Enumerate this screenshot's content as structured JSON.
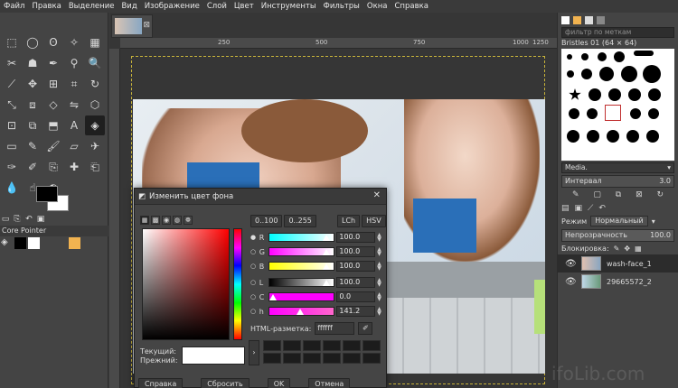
{
  "menubar": [
    "Файл",
    "Правка",
    "Выделение",
    "Вид",
    "Изображение",
    "Слой",
    "Цвет",
    "Инструменты",
    "Фильтры",
    "Окна",
    "Справка"
  ],
  "toolbox": {
    "device_status_label": "Core Pointer"
  },
  "canvas": {
    "ruler_marks": [
      "250",
      "500",
      "750",
      "1000",
      "1250"
    ]
  },
  "dock": {
    "filter_placeholder": "фильтр по меткам",
    "brush_title": "Bristles 01 (64 × 64)",
    "brush_tag": "Media.",
    "interval_label": "Интервал",
    "interval_value": "3.0",
    "mode_label": "Режим",
    "mode_value": "Нормальный",
    "opacity_label": "Непрозрачность",
    "opacity_value": "100.0",
    "lock_label": "Блокировка:",
    "layers": [
      {
        "name": "wash-face_1"
      },
      {
        "name": "29665572_2"
      }
    ]
  },
  "dialog": {
    "title": "Изменить цвет фона",
    "scale_buttons": [
      "0..100",
      "0..255"
    ],
    "model_buttons": [
      "LCh",
      "HSV"
    ],
    "sliders": [
      {
        "label": "R",
        "value": "100.0",
        "gradient": "linear-gradient(to right,#00ffff,#ffffff)"
      },
      {
        "label": "G",
        "value": "100.0",
        "gradient": "linear-gradient(to right,#ff00ff,#ffffff)"
      },
      {
        "label": "B",
        "value": "100.0",
        "gradient": "linear-gradient(to right,#ffff00,#ffffff)"
      },
      {
        "label": "L",
        "value": "100.0",
        "gradient": "linear-gradient(to right,#000000,#ffffff)"
      },
      {
        "label": "C",
        "value": "0.0",
        "gradient": "linear-gradient(to right,#ff00ff,#ff00ff)"
      },
      {
        "label": "h",
        "value": "141.2",
        "gradient": "linear-gradient(to right,#ff00ff,#ff66cc)"
      }
    ],
    "html_label": "HTML-разметка:",
    "html_value": "ffffff",
    "current_label": "Текущий:",
    "previous_label": "Прежний:",
    "buttons": [
      "Справка",
      "Сбросить",
      "OK",
      "Отмена"
    ]
  },
  "watermark": "ifoLib.com",
  "colors": {
    "fg": "#000000",
    "bg": "#ffffff"
  }
}
